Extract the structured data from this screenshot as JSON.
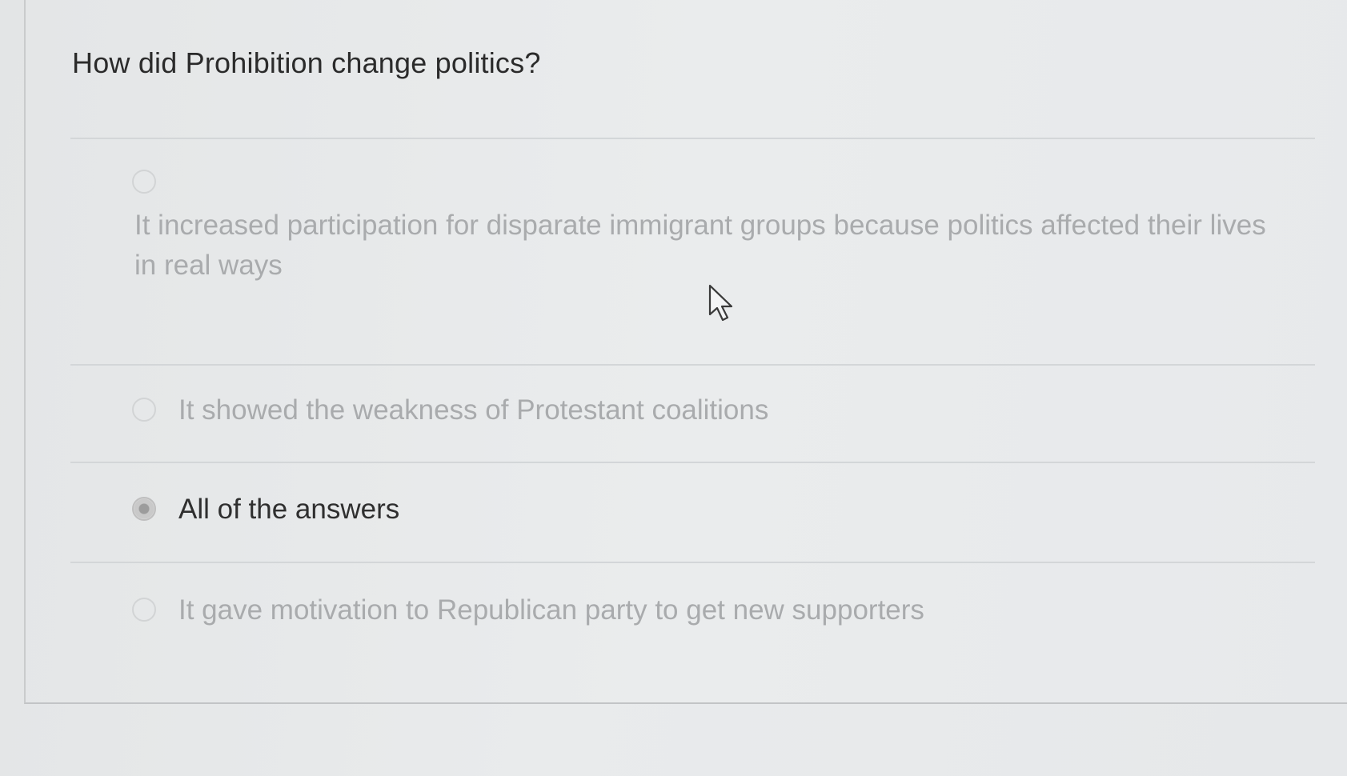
{
  "question": {
    "title": "How did Prohibition change politics?"
  },
  "options": [
    {
      "label": "It increased participation for disparate immigrant groups because politics affected their lives in real ways",
      "selected": false
    },
    {
      "label": "It showed the weakness of Protestant coalitions",
      "selected": false
    },
    {
      "label": "All of the answers",
      "selected": true
    },
    {
      "label": "It gave motivation to Republican party to get new supporters",
      "selected": false
    }
  ],
  "icons": {
    "cursor": "mouse-pointer-icon",
    "radio": "radio-button-icon"
  },
  "colors": {
    "selected_text": "#2f2f2f",
    "unselected_text": "#a9abad"
  }
}
